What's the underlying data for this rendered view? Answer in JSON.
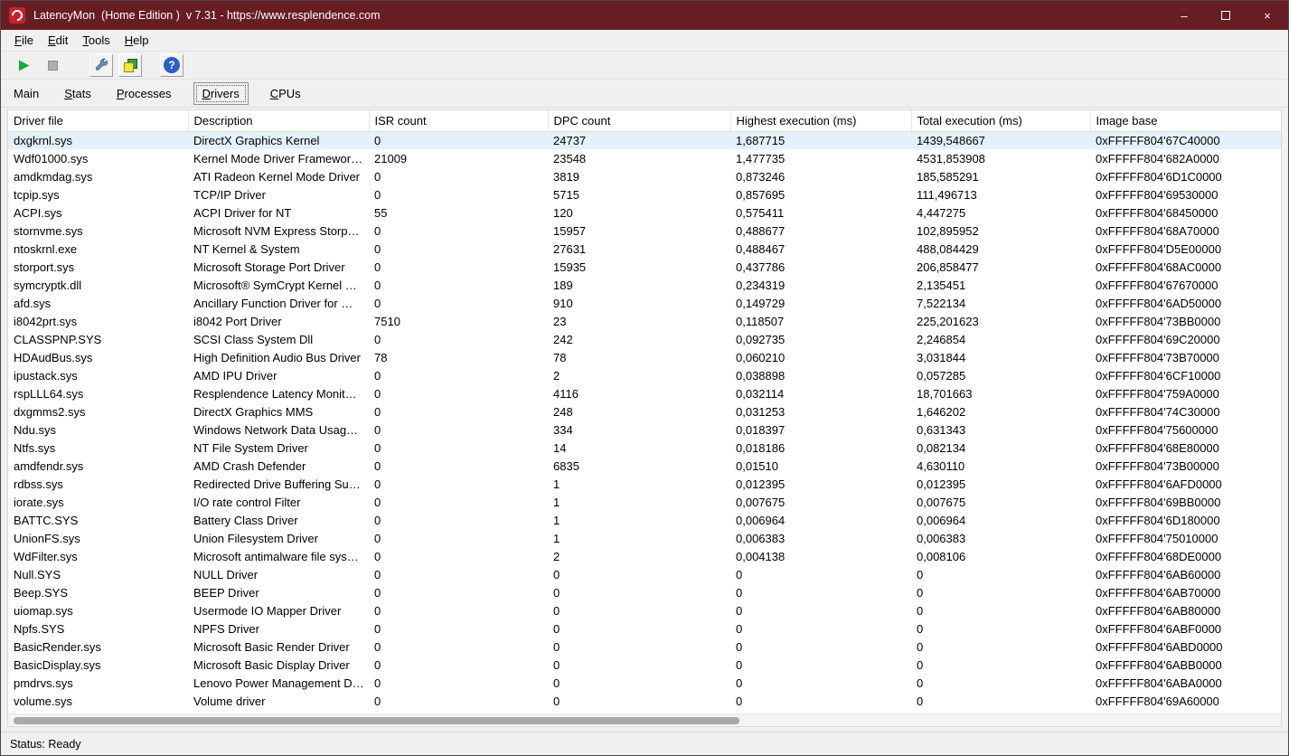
{
  "window": {
    "title": "LatencyMon  (Home Edition )  v 7.31 - https://www.resplendence.com",
    "controls": {
      "minimize_glyph": "–",
      "close_glyph": "×"
    }
  },
  "menu": {
    "items": [
      {
        "label": "File",
        "accel": 0
      },
      {
        "label": "Edit",
        "accel": 0
      },
      {
        "label": "Tools",
        "accel": 0
      },
      {
        "label": "Help",
        "accel": 0
      }
    ]
  },
  "toolbar": {
    "help_glyph": "?",
    "buttons": [
      {
        "name": "start-monitor-button",
        "icon": "play-icon",
        "enabled": true,
        "raised": false
      },
      {
        "name": "stop-monitor-button",
        "icon": "stop-icon",
        "enabled": false,
        "raised": false
      },
      {
        "name": "options-button",
        "icon": "wrench-icon",
        "enabled": true,
        "raised": true
      },
      {
        "name": "report-button",
        "icon": "windows-icon",
        "enabled": true,
        "raised": true
      },
      {
        "name": "help-button",
        "icon": "help-icon",
        "enabled": true,
        "raised": true
      }
    ]
  },
  "tabs": {
    "items": [
      {
        "label": "Main",
        "accel": null,
        "selected": false
      },
      {
        "label": "Stats",
        "accel": 0,
        "selected": false
      },
      {
        "label": "Processes",
        "accel": 0,
        "selected": false
      },
      {
        "label": "Drivers",
        "accel": 0,
        "selected": true
      },
      {
        "label": "CPUs",
        "accel": 0,
        "selected": false
      }
    ]
  },
  "table": {
    "columns": [
      "Driver file",
      "Description",
      "ISR count",
      "DPC count",
      "Highest execution (ms)",
      "Total execution (ms)",
      "Image base"
    ],
    "selected_row_index": 0,
    "rows": [
      [
        "dxgkrnl.sys",
        "DirectX Graphics Kernel",
        "0",
        "24737",
        "1,687715",
        "1439,548667",
        "0xFFFFF804'67C40000"
      ],
      [
        "Wdf01000.sys",
        "Kernel Mode Driver Framewor…",
        "21009",
        "23548",
        "1,477735",
        "4531,853908",
        "0xFFFFF804'682A0000"
      ],
      [
        "amdkmdag.sys",
        "ATI Radeon Kernel Mode Driver",
        "0",
        "3819",
        "0,873246",
        "185,585291",
        "0xFFFFF804'6D1C0000"
      ],
      [
        "tcpip.sys",
        "TCP/IP Driver",
        "0",
        "5715",
        "0,857695",
        "111,496713",
        "0xFFFFF804'69530000"
      ],
      [
        "ACPI.sys",
        "ACPI Driver for NT",
        "55",
        "120",
        "0,575411",
        "4,447275",
        "0xFFFFF804'68450000"
      ],
      [
        "stornvme.sys",
        "Microsoft NVM Express Storp…",
        "0",
        "15957",
        "0,488677",
        "102,895952",
        "0xFFFFF804'68A70000"
      ],
      [
        "ntoskrnl.exe",
        "NT Kernel & System",
        "0",
        "27631",
        "0,488467",
        "488,084429",
        "0xFFFFF804'D5E00000"
      ],
      [
        "storport.sys",
        "Microsoft Storage Port Driver",
        "0",
        "15935",
        "0,437786",
        "206,858477",
        "0xFFFFF804'68AC0000"
      ],
      [
        "symcryptk.dll",
        "Microsoft® SymCrypt Kernel …",
        "0",
        "189",
        "0,234319",
        "2,135451",
        "0xFFFFF804'67670000"
      ],
      [
        "afd.sys",
        "Ancillary Function Driver for …",
        "0",
        "910",
        "0,149729",
        "7,522134",
        "0xFFFFF804'6AD50000"
      ],
      [
        "i8042prt.sys",
        "i8042 Port Driver",
        "7510",
        "23",
        "0,118507",
        "225,201623",
        "0xFFFFF804'73BB0000"
      ],
      [
        "CLASSPNP.SYS",
        "SCSI Class System Dll",
        "0",
        "242",
        "0,092735",
        "2,246854",
        "0xFFFFF804'69C20000"
      ],
      [
        "HDAudBus.sys",
        "High Definition Audio Bus Driver",
        "78",
        "78",
        "0,060210",
        "3,031844",
        "0xFFFFF804'73B70000"
      ],
      [
        "ipustack.sys",
        "AMD IPU Driver",
        "0",
        "2",
        "0,038898",
        "0,057285",
        "0xFFFFF804'6CF10000"
      ],
      [
        "rspLLL64.sys",
        "Resplendence Latency Monit…",
        "0",
        "4116",
        "0,032114",
        "18,701663",
        "0xFFFFF804'759A0000"
      ],
      [
        "dxgmms2.sys",
        "DirectX Graphics MMS",
        "0",
        "248",
        "0,031253",
        "1,646202",
        "0xFFFFF804'74C30000"
      ],
      [
        "Ndu.sys",
        "Windows Network Data Usag…",
        "0",
        "334",
        "0,018397",
        "0,631343",
        "0xFFFFF804'75600000"
      ],
      [
        "Ntfs.sys",
        "NT File System Driver",
        "0",
        "14",
        "0,018186",
        "0,082134",
        "0xFFFFF804'68E80000"
      ],
      [
        "amdfendr.sys",
        "AMD Crash Defender",
        "0",
        "6835",
        "0,01510",
        "4,630110",
        "0xFFFFF804'73B00000"
      ],
      [
        "rdbss.sys",
        "Redirected Drive Buffering Su…",
        "0",
        "1",
        "0,012395",
        "0,012395",
        "0xFFFFF804'6AFD0000"
      ],
      [
        "iorate.sys",
        "I/O rate control Filter",
        "0",
        "1",
        "0,007675",
        "0,007675",
        "0xFFFFF804'69BB0000"
      ],
      [
        "BATTC.SYS",
        "Battery Class Driver",
        "0",
        "1",
        "0,006964",
        "0,006964",
        "0xFFFFF804'6D180000"
      ],
      [
        "UnionFS.sys",
        "Union Filesystem Driver",
        "0",
        "1",
        "0,006383",
        "0,006383",
        "0xFFFFF804'75010000"
      ],
      [
        "WdFilter.sys",
        "Microsoft antimalware file sys…",
        "0",
        "2",
        "0,004138",
        "0,008106",
        "0xFFFFF804'68DE0000"
      ],
      [
        "Null.SYS",
        "NULL Driver",
        "0",
        "0",
        "0",
        "0",
        "0xFFFFF804'6AB60000"
      ],
      [
        "Beep.SYS",
        "BEEP Driver",
        "0",
        "0",
        "0",
        "0",
        "0xFFFFF804'6AB70000"
      ],
      [
        "uiomap.sys",
        "Usermode IO Mapper Driver",
        "0",
        "0",
        "0",
        "0",
        "0xFFFFF804'6AB80000"
      ],
      [
        "Npfs.SYS",
        "NPFS Driver",
        "0",
        "0",
        "0",
        "0",
        "0xFFFFF804'6ABF0000"
      ],
      [
        "BasicRender.sys",
        "Microsoft Basic Render Driver",
        "0",
        "0",
        "0",
        "0",
        "0xFFFFF804'6ABD0000"
      ],
      [
        "BasicDisplay.sys",
        "Microsoft Basic Display Driver",
        "0",
        "0",
        "0",
        "0",
        "0xFFFFF804'6ABB0000"
      ],
      [
        "pmdrvs.sys",
        "Lenovo Power Management D…",
        "0",
        "0",
        "0",
        "0",
        "0xFFFFF804'6ABA0000"
      ],
      [
        "volume.sys",
        "Volume driver",
        "0",
        "0",
        "0",
        "0",
        "0xFFFFF804'69A60000"
      ]
    ]
  },
  "status": {
    "text": "Status: Ready"
  },
  "colors": {
    "titlebar": "#681C23",
    "selection": "#E3F1FC",
    "play_green": "#17A93C",
    "help_blue": "#2B5FC7"
  }
}
